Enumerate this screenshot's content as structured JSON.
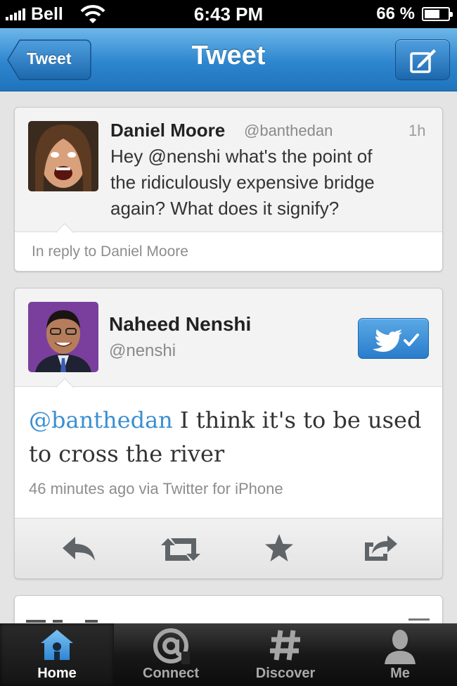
{
  "status_bar": {
    "carrier": "Bell",
    "time": "6:43 PM",
    "battery_percent_text": "66 %",
    "battery_level": 0.66
  },
  "nav": {
    "back_label": "Tweet",
    "title": "Tweet",
    "accent_color": "#2d86ce"
  },
  "parent_tweet": {
    "author_name": "Daniel Moore",
    "author_handle": "@banthedan",
    "age": "1h",
    "text_lines": [
      "Hey @nenshi what's the point of",
      "the ridiculously expensive bridge",
      "again? What does it signify?"
    ],
    "reply_context": "In reply to Daniel Moore"
  },
  "main_tweet": {
    "author_name": "Naheed Nenshi",
    "author_handle": "@nenshi",
    "mention": "@banthedan",
    "text_rest": " I think it's to be used",
    "text_line2": "to cross the river",
    "meta": "46 minutes ago via Twitter for iPhone",
    "mention_color": "#3a8fd1",
    "actions": [
      "reply-icon",
      "retweet-icon",
      "favorite-icon",
      "share-icon"
    ]
  },
  "tabbar": {
    "tabs": [
      {
        "label": "Home",
        "icon": "home-icon",
        "active": true
      },
      {
        "label": "Connect",
        "icon": "at-sign-icon",
        "active": false
      },
      {
        "label": "Discover",
        "icon": "hash-icon",
        "active": false
      },
      {
        "label": "Me",
        "icon": "person-icon",
        "active": false
      }
    ]
  }
}
